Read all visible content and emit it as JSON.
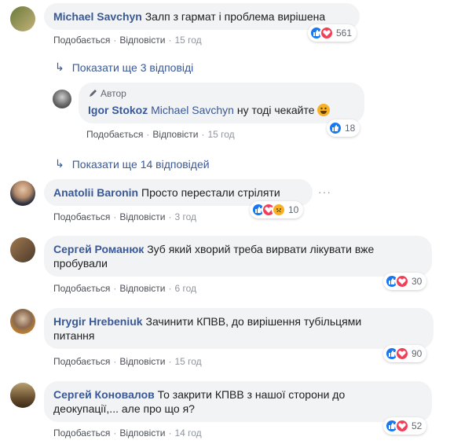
{
  "common": {
    "like": "Подобається",
    "reply": "Відповісти",
    "dot": "·",
    "author_badge": "Автор",
    "colors": {
      "link": "#385898",
      "bubble": "#f2f3f5",
      "like": "#1877f2",
      "love": "#f33e58",
      "haha": "#f7b125"
    }
  },
  "comments": [
    {
      "author": "Michael Savchyn",
      "text": "Залп з гармат і проблема вирішена",
      "time": "15 год",
      "reactions": [
        "like",
        "love"
      ],
      "count": "561"
    },
    {
      "author": "Anatolii Baronin",
      "text": "Просто перестали стріляти",
      "time": "3 год",
      "reactions": [
        "like",
        "love",
        "haha"
      ],
      "count": "10"
    },
    {
      "author": "Сергей Романюк",
      "text": "Зуб який хворий треба вирвати лікувати вже",
      "text2": "пробували",
      "time": "6 год",
      "reactions": [
        "like",
        "love"
      ],
      "count": "30"
    },
    {
      "author": "Hrygir Hrebeniuk",
      "text": "Зачинити КПВВ, до вирішення тубільцями",
      "text2": "питання",
      "time": "15 год",
      "reactions": [
        "like",
        "love"
      ],
      "count": "90"
    },
    {
      "author": "Сергей Коновалов",
      "text": "То закрити КПВВ з нашої сторони до",
      "text2": "деокупації,... але про що я?",
      "time": "14 год",
      "reactions": [
        "like",
        "love"
      ],
      "count": "52"
    }
  ],
  "reply": {
    "author": "Igor Stokoz",
    "mention": "Michael Savchyn",
    "text": "ну тоді чекайте",
    "time": "15 год",
    "reactions": [
      "like"
    ],
    "count": "18"
  },
  "more_replies_1": "Показати ще 3 відповіді",
  "more_replies_2": "Показати ще 14 відповідей"
}
